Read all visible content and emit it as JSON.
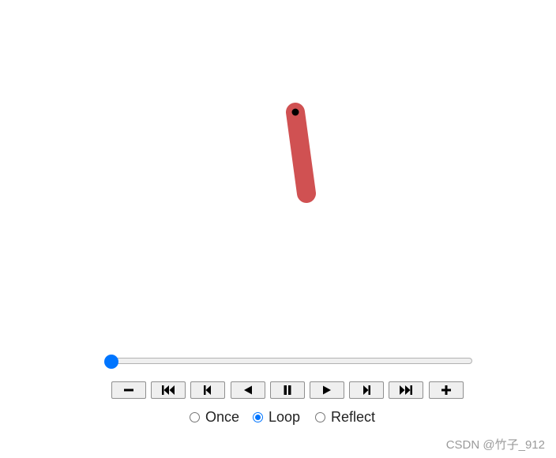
{
  "animation": {
    "frame_progress": 0.0,
    "pendulum": {
      "rod_color": "#d05152",
      "pivot_color": "#000000"
    }
  },
  "slider": {
    "value": 0,
    "accent_color": "#0075ff"
  },
  "controls": {
    "buttons": [
      {
        "name": "decrease-speed-button",
        "icon": "minus-icon"
      },
      {
        "name": "first-frame-button",
        "icon": "skip-first-icon"
      },
      {
        "name": "previous-frame-button",
        "icon": "step-back-icon"
      },
      {
        "name": "play-reverse-button",
        "icon": "play-reverse-icon"
      },
      {
        "name": "pause-button",
        "icon": "pause-icon"
      },
      {
        "name": "play-button",
        "icon": "play-icon"
      },
      {
        "name": "next-frame-button",
        "icon": "step-forward-icon"
      },
      {
        "name": "last-frame-button",
        "icon": "skip-last-icon"
      },
      {
        "name": "increase-speed-button",
        "icon": "plus-icon"
      }
    ]
  },
  "modes": {
    "options": [
      "Once",
      "Loop",
      "Reflect"
    ],
    "selected": "Loop"
  },
  "watermark": "CSDN @竹子_912"
}
